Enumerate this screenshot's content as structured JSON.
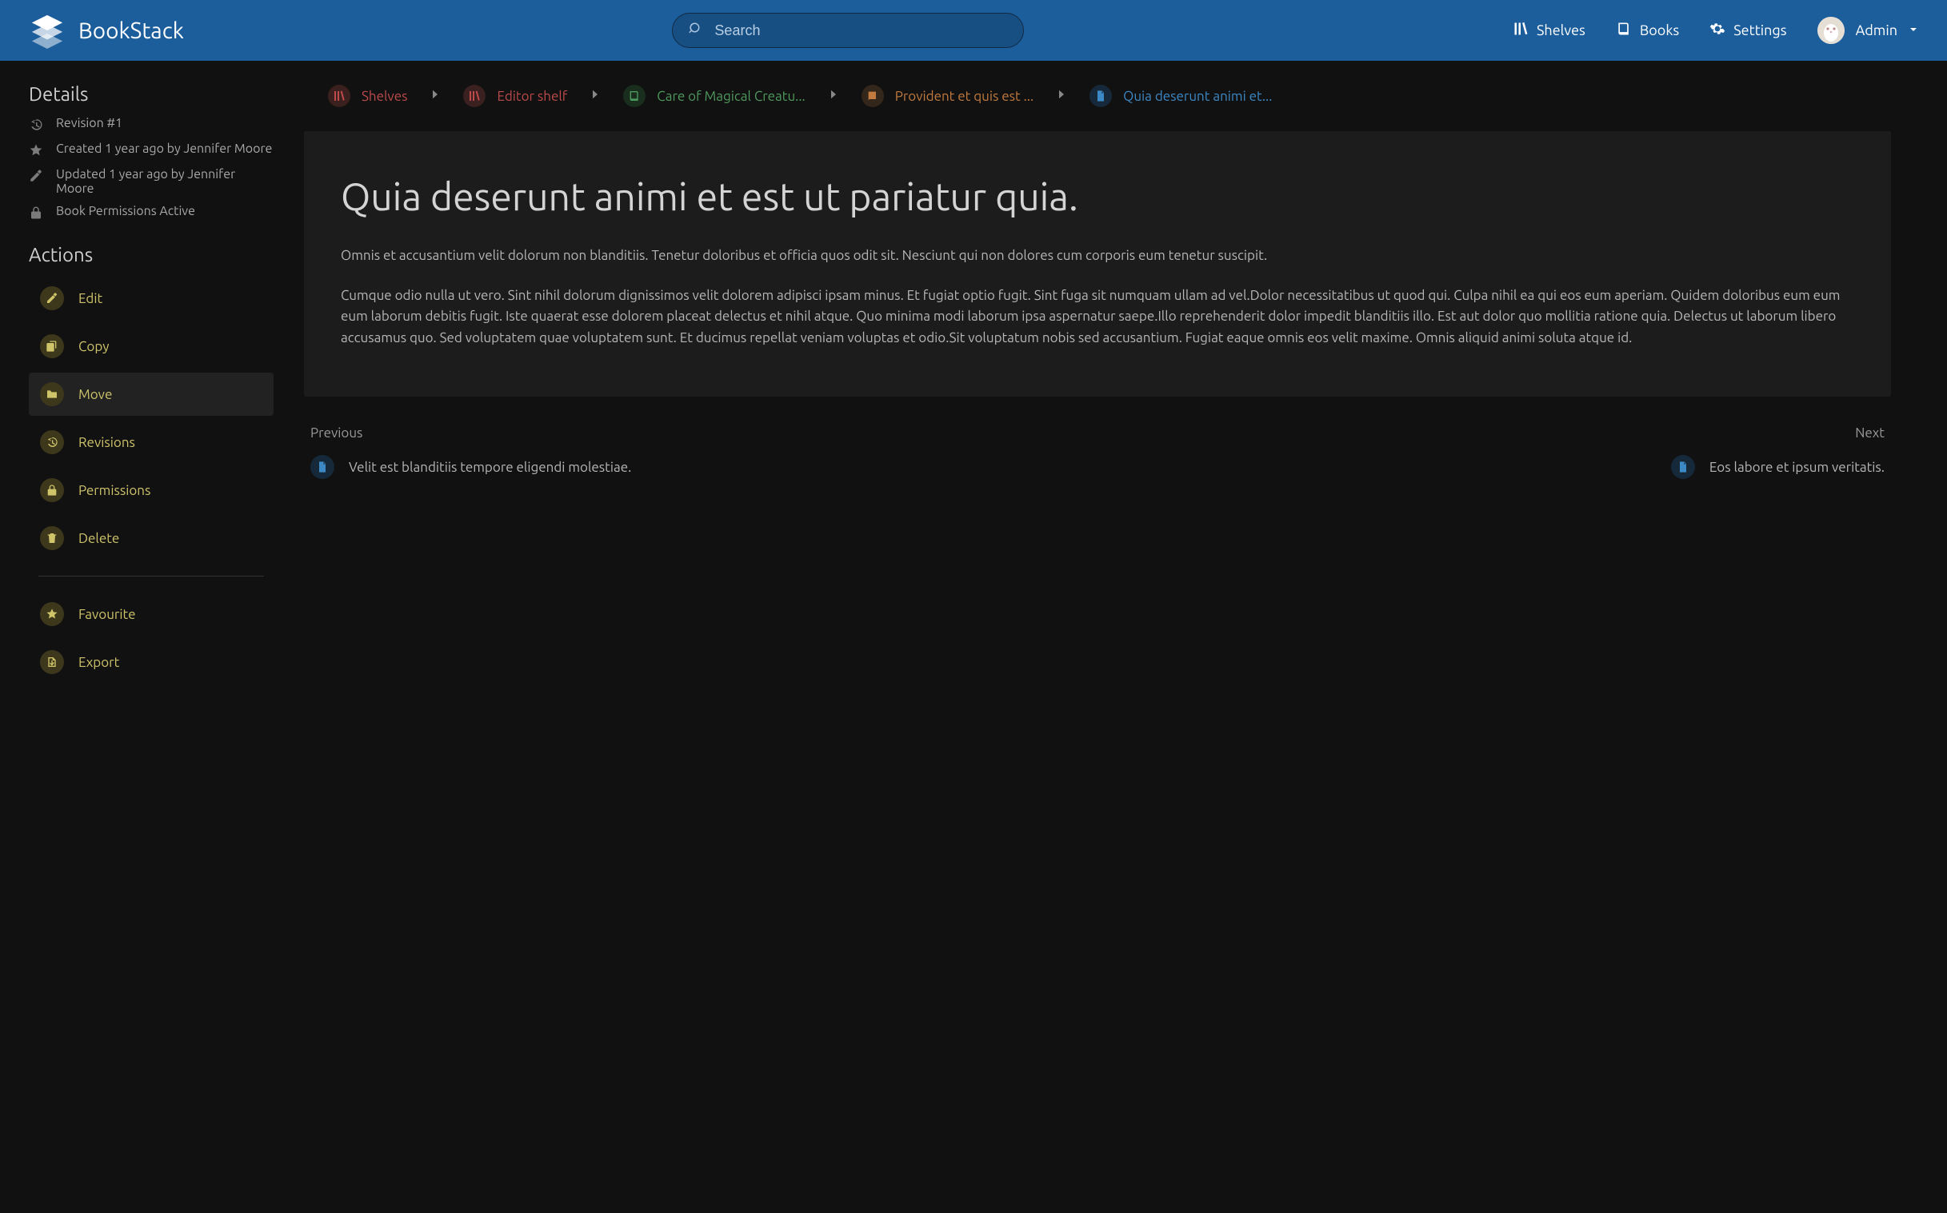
{
  "header": {
    "brand": "BookStack",
    "search_placeholder": "Search",
    "nav": {
      "shelves": "Shelves",
      "books": "Books",
      "settings": "Settings"
    },
    "user_name": "Admin"
  },
  "sidebar": {
    "details_heading": "Details",
    "details": {
      "revision": "Revision #1",
      "created": "Created 1 year ago by Jennifer Moore",
      "updated": "Updated 1 year ago by Jennifer Moore",
      "permissions": "Book Permissions Active"
    },
    "actions_heading": "Actions",
    "actions": {
      "edit": "Edit",
      "copy": "Copy",
      "move": "Move",
      "revisions": "Revisions",
      "permissions": "Permissions",
      "delete": "Delete",
      "favourite": "Favourite",
      "export": "Export"
    }
  },
  "breadcrumbs": {
    "shelves": "Shelves",
    "shelf": "Editor shelf",
    "book": "Care of Magical Creatu...",
    "chapter": "Provident et quis est ...",
    "page": "Quia deserunt animi et..."
  },
  "page": {
    "title": "Quia deserunt animi et est ut pariatur quia.",
    "para1": "Omnis et accusantium velit dolorum non blanditiis. Tenetur doloribus et officia quos odit sit. Nesciunt qui non dolores cum corporis eum tenetur suscipit.",
    "para2": "Cumque odio nulla ut vero. Sint nihil dolorum dignissimos velit dolorem adipisci ipsam minus. Et fugiat optio fugit. Sint fuga sit numquam ullam ad vel.Dolor necessitatibus ut quod qui. Culpa nihil ea qui eos eum aperiam. Quidem doloribus eum eum eum laborum debitis fugit. Iste quaerat esse dolorem placeat delectus et nihil atque. Quo minima modi laborum ipsa aspernatur saepe.Illo reprehenderit dolor impedit blanditiis illo. Est aut dolor quo mollitia ratione quia. Delectus ut laborum libero accusamus quo. Sed voluptatem quae voluptatem sunt. Et ducimus repellat veniam voluptas et odio.Sit voluptatum nobis sed accusantium. Fugiat eaque omnis eos velit maxime. Omnis aliquid animi soluta atque id."
  },
  "pager": {
    "prev_label": "Previous",
    "next_label": "Next",
    "prev_title": "Velit est blanditiis tempore eligendi molestiae.",
    "next_title": "Eos labore et ipsum veritatis."
  }
}
